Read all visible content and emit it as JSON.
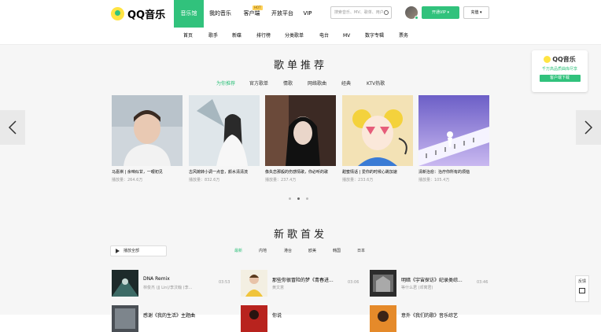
{
  "brand": {
    "logo_text": "QQ音乐"
  },
  "main_nav": [
    {
      "label": "音乐馆",
      "active": true
    },
    {
      "label": "我的音乐"
    },
    {
      "label": "客户端"
    },
    {
      "label": "开放平台"
    },
    {
      "label": "VIP"
    }
  ],
  "hot_badge": "HOT",
  "search": {
    "placeholder": "搜索音乐、MV、歌单、用户"
  },
  "header_buttons": {
    "vip": "开通VIP ▾",
    "pay": "充值 ▾"
  },
  "sub_nav": [
    "首页",
    "歌手",
    "新碟",
    "排行榜",
    "分类歌单",
    "电台",
    "MV",
    "数字专辑",
    "票务"
  ],
  "recommend": {
    "title": "歌单推荐",
    "tabs": [
      {
        "label": "为你推荐",
        "active": true
      },
      {
        "label": "官方歌单"
      },
      {
        "label": "情歌"
      },
      {
        "label": "网络歌曲"
      },
      {
        "label": "经典"
      },
      {
        "label": "KTV热歌"
      }
    ],
    "cards": [
      {
        "name": "马嘉祺 | 余味似甘，一眼初见",
        "plays": "播放量：264.6万"
      },
      {
        "name": "古风婉转小调一点音，颜水清清流",
        "plays": "播放量：832.6万"
      },
      {
        "name": "像失恋那般的伤感情歌，你必听的歌",
        "plays": "播放量：237.4万"
      },
      {
        "name": "甜蜜情话 | 爱你的时候心跳加速",
        "plays": "播放量：233.6万"
      },
      {
        "name": "清新治愈：治疗你所有的烦恼",
        "plays": "播放量：105.4万"
      }
    ]
  },
  "ad": {
    "logo": "QQ音乐",
    "sub": "千万高品质曲库尽享",
    "button": "客户端下载"
  },
  "newsongs": {
    "title": "新歌首发",
    "play_all": "播放全部",
    "tabs": [
      {
        "label": "最新",
        "active": true
      },
      {
        "label": "内地"
      },
      {
        "label": "港台"
      },
      {
        "label": "欧美"
      },
      {
        "label": "韩国"
      },
      {
        "label": "日本"
      }
    ],
    "songs": [
      {
        "title": "DNA Remix",
        "artist": "林俊杰 (JJ Lin)/李汶翰 (李...",
        "duration": "03:53"
      },
      {
        "title": "那些你很冒险的梦《青春进...",
        "artist": "黄文意",
        "duration": "03:06"
      },
      {
        "title": "明暗《宇宙探访》纪录类综...",
        "artist": "等什么君 (邓寓君)",
        "duration": "03:46"
      }
    ],
    "songs_row2": [
      {
        "title": "感谢《我的生活》主题曲"
      },
      {
        "title": "你说"
      },
      {
        "title": "意外《我们的歌》音乐综艺"
      }
    ]
  },
  "side_tools": {
    "feedback": "反馈"
  }
}
